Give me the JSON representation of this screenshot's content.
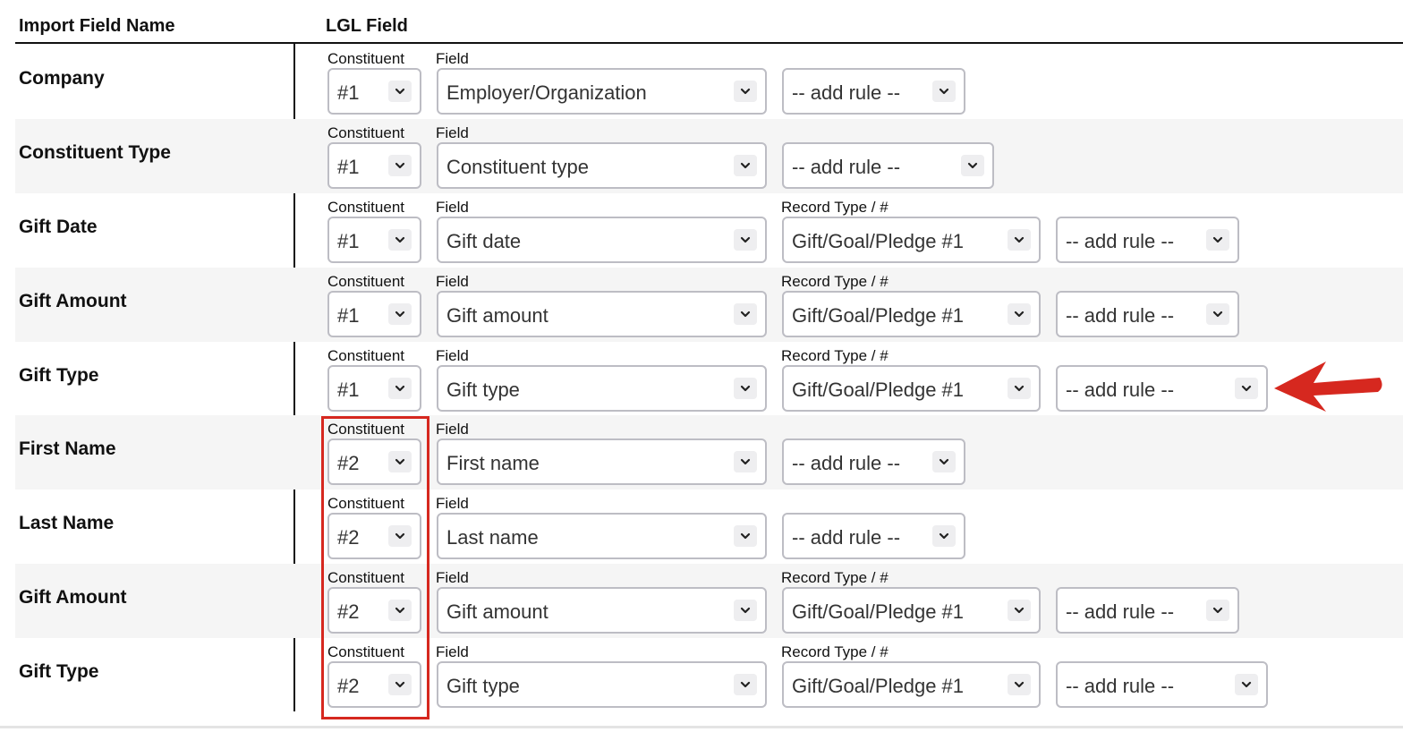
{
  "header": {
    "import_field_name": "Import Field Name",
    "lgl_field": "LGL Field"
  },
  "captions": {
    "constituent": "Constituent",
    "field": "Field",
    "record_type": "Record Type / #"
  },
  "rows": [
    {
      "label": "Company",
      "constituent": "#1",
      "field": "Employer/Organization",
      "rule": "-- add rule --"
    },
    {
      "label": "Constituent Type",
      "constituent": "#1",
      "field": "Constituent type",
      "rule": "-- add rule --"
    },
    {
      "label": "Gift Date",
      "constituent": "#1",
      "field": "Gift date",
      "record_type": "Gift/Goal/Pledge #1",
      "rule": "-- add rule --"
    },
    {
      "label": "Gift Amount",
      "constituent": "#1",
      "field": "Gift amount",
      "record_type": "Gift/Goal/Pledge #1",
      "rule": "-- add rule --"
    },
    {
      "label": "Gift Type",
      "constituent": "#1",
      "field": "Gift type",
      "record_type": "Gift/Goal/Pledge #1",
      "rule": "-- add rule --"
    },
    {
      "label": "First Name",
      "constituent": "#2",
      "field": "First name",
      "rule": "-- add rule --"
    },
    {
      "label": "Last Name",
      "constituent": "#2",
      "field": "Last name",
      "rule": "-- add rule --"
    },
    {
      "label": "Gift Amount",
      "constituent": "#2",
      "field": "Gift amount",
      "record_type": "Gift/Goal/Pledge #1",
      "rule": "-- add rule --"
    },
    {
      "label": "Gift Type",
      "constituent": "#2",
      "field": "Gift type",
      "record_type": "Gift/Goal/Pledge #1",
      "rule": "-- add rule --"
    }
  ],
  "icons": {
    "dropdown": "chevron-down-icon",
    "annotation_arrow": "arrow-left-icon"
  },
  "colors": {
    "annotation": "#d6281f",
    "select_border": "#bdbdc4",
    "shaded_row": "#f5f5f5"
  }
}
